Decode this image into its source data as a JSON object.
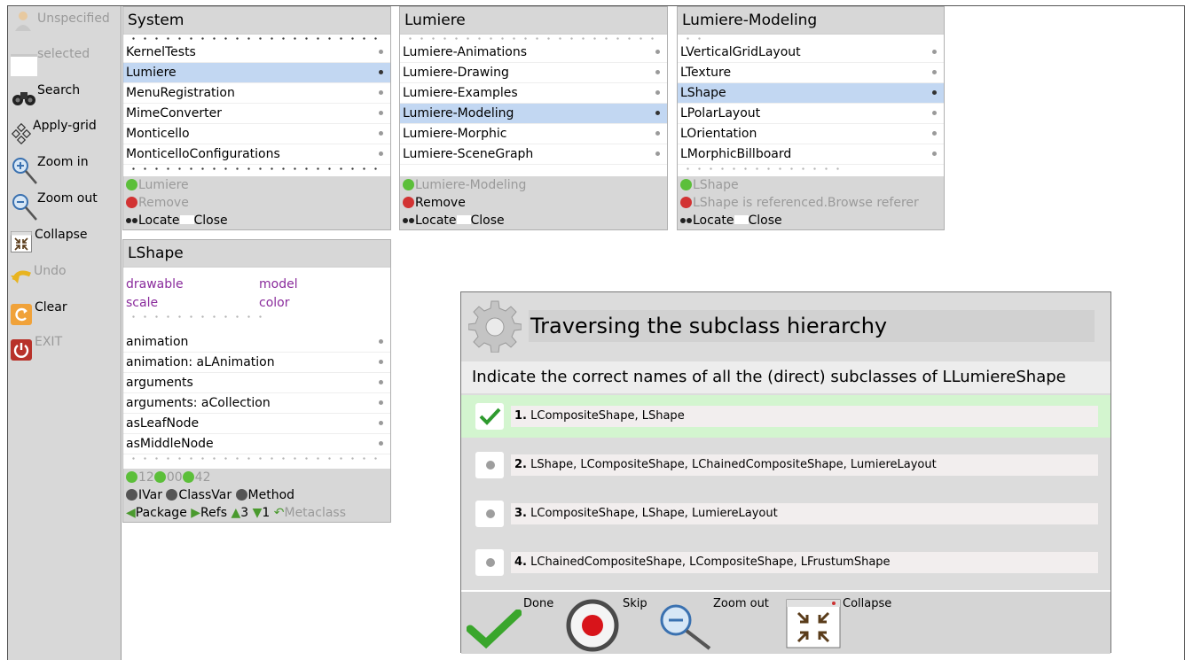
{
  "toolbar": {
    "items": [
      {
        "label": "Unspecified",
        "icon": "person-icon",
        "enabled": false
      },
      {
        "label": "selected",
        "icon": "blank-window-icon",
        "enabled": false
      },
      {
        "label": "Search",
        "icon": "binoculars-icon",
        "enabled": true
      },
      {
        "label": "Apply-grid",
        "icon": "grid-icon",
        "enabled": true
      },
      {
        "label": "Zoom in",
        "icon": "zoom-in-icon",
        "enabled": true
      },
      {
        "label": "Zoom out",
        "icon": "zoom-out-icon",
        "enabled": true
      },
      {
        "label": "Collapse",
        "icon": "collapse-icon",
        "enabled": true
      },
      {
        "label": "Undo",
        "icon": "undo-icon",
        "enabled": false
      },
      {
        "label": "Clear",
        "icon": "clear-icon",
        "enabled": true
      },
      {
        "label": "EXIT",
        "icon": "power-icon",
        "enabled": false
      }
    ]
  },
  "system_panel": {
    "title": "System",
    "items": [
      "KernelTests",
      "Lumiere",
      "MenuRegistration",
      "MimeConverter",
      "Monticello",
      "MonticelloConfigurations"
    ],
    "selected_index": 1,
    "footer_name": "Lumiere",
    "remove_label": "Remove",
    "locate_label": "Locate",
    "close_label": "Close"
  },
  "lumiere_panel": {
    "title": "Lumiere",
    "items": [
      "Lumiere-Animations",
      "Lumiere-Drawing",
      "Lumiere-Examples",
      "Lumiere-Modeling",
      "Lumiere-Morphic",
      "Lumiere-SceneGraph"
    ],
    "selected_index": 3,
    "footer_name": "Lumiere-Modeling",
    "remove_label": "Remove",
    "locate_label": "Locate",
    "close_label": "Close"
  },
  "modeling_panel": {
    "title": "Lumiere-Modeling",
    "items": [
      "LVerticalGridLayout",
      "LTexture",
      "LShape",
      "LPolarLayout",
      "LOrientation",
      "LMorphicBillboard"
    ],
    "selected_index": 2,
    "footer_name": "LShape",
    "referenced_text": "LShape is referenced.Browse referer",
    "locate_label": "Locate",
    "close_label": "Close"
  },
  "lshape_panel": {
    "title": "LShape",
    "vars": [
      [
        "drawable",
        "model"
      ],
      [
        "scale",
        "color"
      ]
    ],
    "methods": [
      "animation",
      "animation: aLAnimation",
      "arguments",
      "arguments: aCollection",
      "asLeafNode",
      "asMiddleNode"
    ],
    "counts": {
      "i": "12",
      "c": "0",
      "c_label": "0",
      "m": "42"
    },
    "add_ivar": "IVar",
    "add_classvar": "ClassVar",
    "add_method": "Method",
    "package_label": "Package",
    "refs_label": "Refs",
    "up_count": "3",
    "down_count": "1",
    "metaclass_label": "Metaclass"
  },
  "quiz": {
    "title": "Traversing the subclass hierarchy",
    "question": "Indicate the correct names of all the (direct) subclasses of LLumiereShape",
    "options": [
      {
        "num": "1",
        "text": "LCompositeShape, LShape",
        "correct": true
      },
      {
        "num": "2",
        "text": "LShape, LCompositeShape, LChainedCompositeShape, LumiereLayout",
        "correct": false
      },
      {
        "num": "3",
        "text": "LCompositeShape, LShape, LumiereLayout",
        "correct": false
      },
      {
        "num": "4",
        "text": "LChainedCompositeShape, LCompositeShape, LFrustumShape",
        "correct": false
      }
    ],
    "buttons": {
      "done": "Done",
      "skip": "Skip",
      "zoom_out": "Zoom out",
      "collapse": "Collapse"
    }
  },
  "colors": {
    "selection": "#c2d7f2",
    "correct": "#d3f5cf",
    "accent_green": "#3aa62c",
    "skip_red": "#d8141a"
  }
}
